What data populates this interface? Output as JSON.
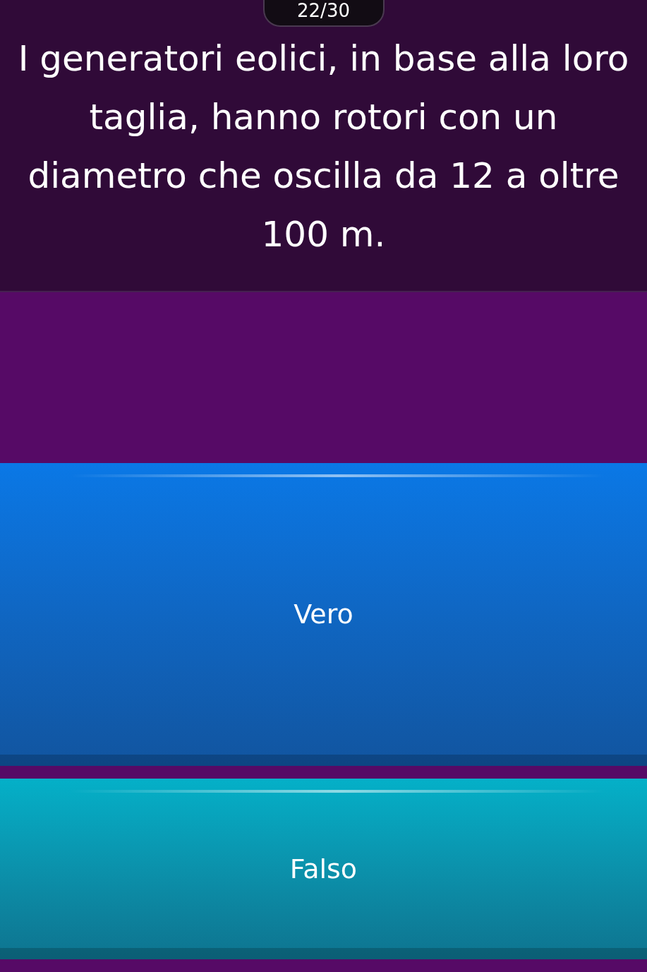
{
  "counter": "22/30",
  "question": "I generatori eolici, in base alla loro taglia, hanno rotori con un diametro che oscilla da 12 a oltre 100 m.",
  "answers": [
    {
      "label": "Vero",
      "color": "#0a78e6"
    },
    {
      "label": "Falso",
      "color": "#04b0c8"
    }
  ]
}
